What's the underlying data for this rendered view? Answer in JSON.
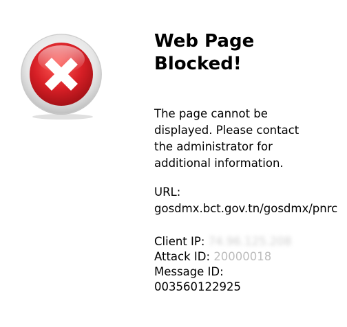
{
  "icon": {
    "name": "blocked-x-icon",
    "outer_ring_color": "#e3e3e3",
    "red_color": "#d71f26",
    "x_color": "#ffffff"
  },
  "title": "Web Page Blocked!",
  "message": "The page cannot be displayed. Please contact the administrator for additional information.",
  "url": {
    "label": "URL:",
    "value": "gosdmx.bct.gov.tn/gosdmx/pnrc"
  },
  "details": {
    "client_ip_label": "Client IP:",
    "client_ip_value": "74.96.125.208",
    "attack_id_label": "Attack ID:",
    "attack_id_value": "20000018",
    "message_id_label": "Message ID:",
    "message_id_value": "003560122925"
  }
}
